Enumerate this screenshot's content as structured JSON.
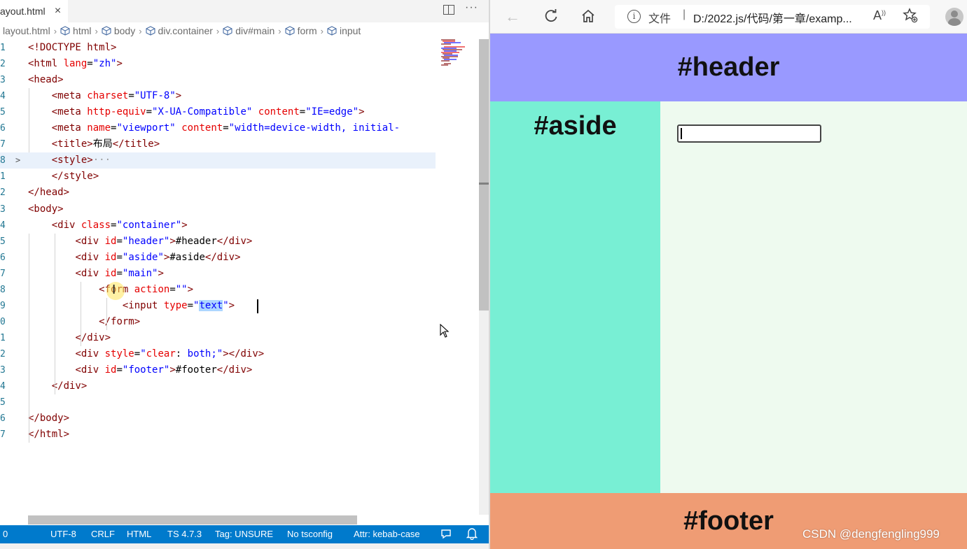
{
  "editor": {
    "tab": {
      "label": "ayout.html",
      "close_icon": "×"
    },
    "more_icon": "···",
    "breadcrumb": [
      "layout.html",
      "html",
      "body",
      "div.container",
      "div#main",
      "form",
      "input"
    ],
    "lines": [
      {
        "num": "1",
        "tokens": [
          [
            "t",
            "<!DOCTYPE html>"
          ]
        ]
      },
      {
        "num": "2",
        "tokens": [
          [
            "t",
            "<html "
          ],
          [
            "a",
            "lang"
          ],
          [
            "x",
            "="
          ],
          [
            "s",
            "\"zh\""
          ],
          [
            "t",
            ">"
          ]
        ]
      },
      {
        "num": "3",
        "tokens": [
          [
            "t",
            "<head>"
          ]
        ]
      },
      {
        "num": "4",
        "tokens": [
          [
            "x",
            "    "
          ],
          [
            "t",
            "<meta "
          ],
          [
            "a",
            "charset"
          ],
          [
            "x",
            "="
          ],
          [
            "s",
            "\"UTF-8\""
          ],
          [
            "t",
            ">"
          ]
        ]
      },
      {
        "num": "5",
        "tokens": [
          [
            "x",
            "    "
          ],
          [
            "t",
            "<meta "
          ],
          [
            "a",
            "http-equiv"
          ],
          [
            "x",
            "="
          ],
          [
            "s",
            "\"X-UA-Compatible\""
          ],
          [
            "x",
            " "
          ],
          [
            "a",
            "content"
          ],
          [
            "x",
            "="
          ],
          [
            "s",
            "\"IE=edge\""
          ],
          [
            "t",
            ">"
          ]
        ]
      },
      {
        "num": "6",
        "tokens": [
          [
            "x",
            "    "
          ],
          [
            "t",
            "<meta "
          ],
          [
            "a",
            "name"
          ],
          [
            "x",
            "="
          ],
          [
            "s",
            "\"viewport\""
          ],
          [
            "x",
            " "
          ],
          [
            "a",
            "content"
          ],
          [
            "x",
            "="
          ],
          [
            "s",
            "\"width=device-width, initial-"
          ]
        ]
      },
      {
        "num": "7",
        "tokens": [
          [
            "x",
            "    "
          ],
          [
            "t",
            "<title>"
          ],
          [
            "x",
            "布局"
          ],
          [
            "t",
            "</title>"
          ]
        ]
      },
      {
        "num": "8",
        "fold": ">",
        "current": true,
        "tokens": [
          [
            "x",
            "    "
          ],
          [
            "t",
            "<style>"
          ],
          [
            "d",
            "···"
          ]
        ]
      },
      {
        "num": "1",
        "tokens": [
          [
            "x",
            "    "
          ],
          [
            "t",
            "</style>"
          ]
        ]
      },
      {
        "num": "2",
        "tokens": [
          [
            "t",
            "</head>"
          ]
        ]
      },
      {
        "num": "3",
        "tokens": [
          [
            "t",
            "<body>"
          ]
        ]
      },
      {
        "num": "4",
        "tokens": [
          [
            "x",
            "    "
          ],
          [
            "t",
            "<div "
          ],
          [
            "a",
            "class"
          ],
          [
            "x",
            "="
          ],
          [
            "s",
            "\"container\""
          ],
          [
            "t",
            ">"
          ]
        ]
      },
      {
        "num": "5",
        "tokens": [
          [
            "x",
            "        "
          ],
          [
            "t",
            "<div "
          ],
          [
            "a",
            "id"
          ],
          [
            "x",
            "="
          ],
          [
            "s",
            "\"header\""
          ],
          [
            "t",
            ">"
          ],
          [
            "x",
            "#header"
          ],
          [
            "t",
            "</div>"
          ]
        ]
      },
      {
        "num": "6",
        "tokens": [
          [
            "x",
            "        "
          ],
          [
            "t",
            "<div "
          ],
          [
            "a",
            "id"
          ],
          [
            "x",
            "="
          ],
          [
            "s",
            "\"aside\""
          ],
          [
            "t",
            ">"
          ],
          [
            "x",
            "#aside"
          ],
          [
            "t",
            "</div>"
          ]
        ]
      },
      {
        "num": "7",
        "tokens": [
          [
            "x",
            "        "
          ],
          [
            "t",
            "<div "
          ],
          [
            "a",
            "id"
          ],
          [
            "x",
            "="
          ],
          [
            "s",
            "\"main\""
          ],
          [
            "t",
            ">"
          ]
        ]
      },
      {
        "num": "8",
        "tokens": [
          [
            "x",
            "            "
          ],
          [
            "t",
            "<form "
          ],
          [
            "a",
            "action"
          ],
          [
            "x",
            "="
          ],
          [
            "s",
            "\"\""
          ],
          [
            "t",
            ">"
          ]
        ]
      },
      {
        "num": "9",
        "tokens": [
          [
            "x",
            "                "
          ],
          [
            "t",
            "<input "
          ],
          [
            "a",
            "type"
          ],
          [
            "x",
            "="
          ],
          [
            "s",
            "\""
          ],
          [
            "S",
            "text"
          ],
          [
            "s",
            "\""
          ],
          [
            "t",
            ">"
          ]
        ]
      },
      {
        "num": "0",
        "tokens": [
          [
            "x",
            "            "
          ],
          [
            "t",
            "</form>"
          ]
        ]
      },
      {
        "num": "1",
        "tokens": [
          [
            "x",
            "        "
          ],
          [
            "t",
            "</div>"
          ]
        ]
      },
      {
        "num": "2",
        "tokens": [
          [
            "x",
            "        "
          ],
          [
            "t",
            "<div "
          ],
          [
            "a",
            "style"
          ],
          [
            "x",
            "="
          ],
          [
            "s",
            "\""
          ],
          [
            "a",
            "clear"
          ],
          [
            "x",
            ": "
          ],
          [
            "s",
            "both;\""
          ],
          [
            "t",
            "></div>"
          ]
        ]
      },
      {
        "num": "3",
        "tokens": [
          [
            "x",
            "        "
          ],
          [
            "t",
            "<div "
          ],
          [
            "a",
            "id"
          ],
          [
            "x",
            "="
          ],
          [
            "s",
            "\"footer\""
          ],
          [
            "t",
            ">"
          ],
          [
            "x",
            "#footer"
          ],
          [
            "t",
            "</div>"
          ]
        ]
      },
      {
        "num": "4",
        "tokens": [
          [
            "x",
            "    "
          ],
          [
            "t",
            "</div>"
          ]
        ]
      },
      {
        "num": "5",
        "tokens": []
      },
      {
        "num": "6",
        "tokens": [
          [
            "t",
            "</body>"
          ]
        ]
      },
      {
        "num": "7",
        "tokens": [
          [
            "t",
            "</html>"
          ]
        ]
      }
    ],
    "status": {
      "errors": "0",
      "encoding": "UTF-8",
      "eol": "CRLF",
      "language": "HTML",
      "ts_version": "TS 4.7.3",
      "tag": "Tag: UNSURE",
      "tsconfig": "No tsconfig",
      "attr": "Attr: kebab-case",
      "feedback_icon": "feedback-icon",
      "bell_icon": "bell-icon"
    },
    "colors": {
      "statusbar": "#007acc",
      "tag": "#800000",
      "attr": "#e50000",
      "string": "#0000ff"
    }
  },
  "browser": {
    "address": {
      "file_label": "文件",
      "separator": "|",
      "url": "D:/2022.js/代码/第一章/examp..."
    },
    "page": {
      "header": "#header",
      "aside": "#aside",
      "footer": "#footer",
      "input_value": ""
    },
    "colors": {
      "header": "#9999ff",
      "aside": "#78efd4",
      "main": "#eefaef",
      "footer": "#ef9c74"
    }
  },
  "watermark": "CSDN @dengfengling999"
}
